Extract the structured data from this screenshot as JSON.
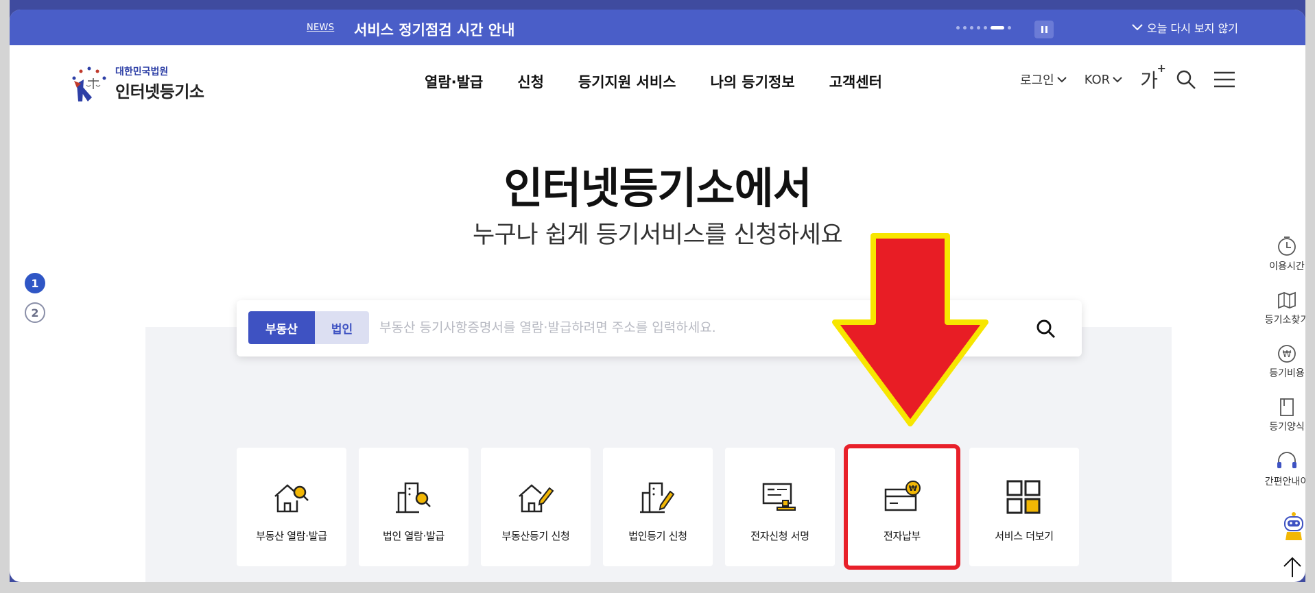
{
  "news": {
    "tag": "NEWS",
    "title": "서비스 정기점검 시간 안내",
    "dismiss": "오늘 다시 보지 않기"
  },
  "header": {
    "logo_top": "대한민국법원",
    "logo_main": "인터넷등기소",
    "nav": [
      "열람·발급",
      "신청",
      "등기지원 서비스",
      "나의 등기정보",
      "고객센터"
    ],
    "login": "로그인",
    "language": "KOR",
    "font_size_label": "가"
  },
  "hero": {
    "title": "인터넷등기소에서",
    "subtitle": "누구나 쉽게 등기서비스를 신청하세요"
  },
  "pager": [
    "1",
    "2"
  ],
  "search": {
    "tabs": [
      "부동산",
      "법인"
    ],
    "placeholder": "부동산 등기사항증명서를 열람·발급하려면 주소를 입력하세요."
  },
  "services": [
    {
      "label": "부동산 열람·발급",
      "icon": "house-search-icon"
    },
    {
      "label": "법인 열람·발급",
      "icon": "building-search-icon"
    },
    {
      "label": "부동산등기 신청",
      "icon": "house-pen-icon"
    },
    {
      "label": "법인등기 신청",
      "icon": "building-pen-icon"
    },
    {
      "label": "전자신청 서명",
      "icon": "e-sign-icon"
    },
    {
      "label": "전자납부",
      "icon": "e-payment-icon"
    },
    {
      "label": "서비스 더보기",
      "icon": "grid-icon"
    }
  ],
  "quick_menu": [
    "이용시간",
    "등기소찾기",
    "등기비용",
    "등기양식",
    "간편안내이"
  ],
  "colors": {
    "news_bar": "#4a5ec8",
    "primary": "#3e52c2",
    "highlight_red": "#e8202a",
    "arrow_yellow": "#f7e600",
    "icon_accent": "#f2b705"
  }
}
